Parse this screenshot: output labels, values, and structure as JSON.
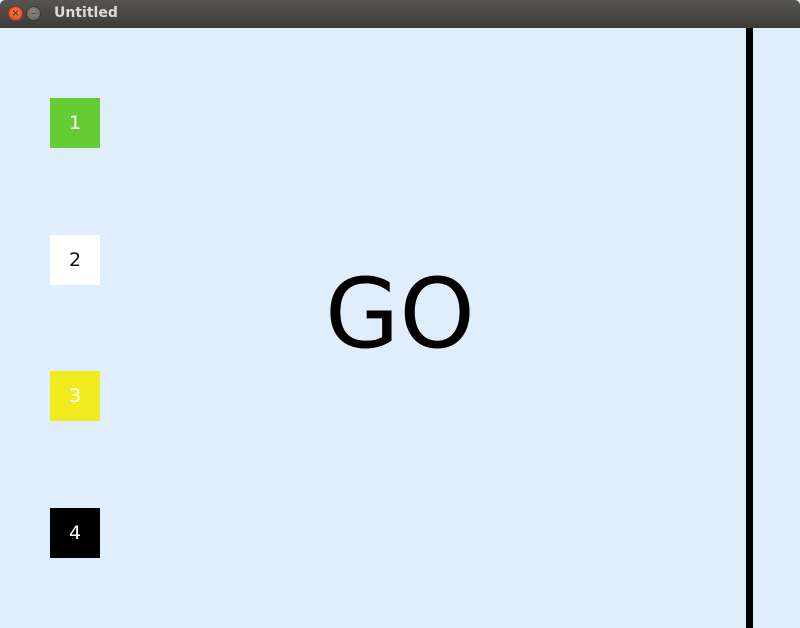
{
  "window": {
    "title": "Untitled",
    "close_glyph": "×",
    "minimize_glyph": "–"
  },
  "boxes": [
    {
      "label": "1",
      "color": "#66cc33"
    },
    {
      "label": "2",
      "color": "#ffffff"
    },
    {
      "label": "3",
      "color": "#f0ea1e"
    },
    {
      "label": "4",
      "color": "#000000"
    }
  ],
  "main": {
    "go_text": "GO"
  },
  "colors": {
    "background": "#e0eefb",
    "line": "#000000"
  }
}
